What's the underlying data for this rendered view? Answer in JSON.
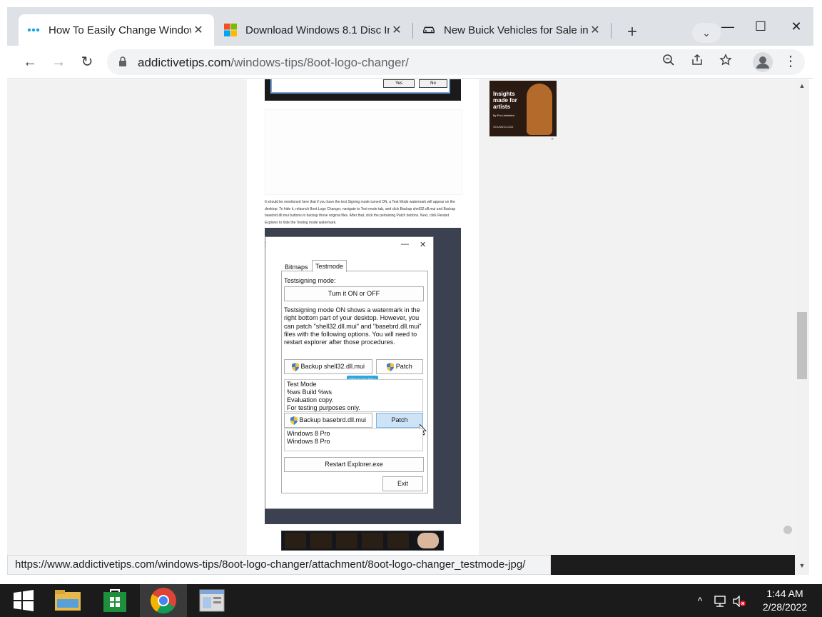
{
  "browser": {
    "tabs": [
      {
        "title": "How To Easily Change Windows 8",
        "active": true,
        "favicon": "dots-icon"
      },
      {
        "title": "Download Windows 8.1 Disc Image",
        "active": false,
        "favicon": "microsoft-logo-icon"
      },
      {
        "title": "New Buick Vehicles for Sale in",
        "active": false,
        "favicon": "car-icon"
      }
    ],
    "new_tab_label": "+",
    "url_host": "addictivetips.com",
    "url_path": "/windows-tips/8oot-logo-changer/",
    "status_url": "https://www.addictivetips.com/windows-tips/8oot-logo-changer/attachment/8oot-logo-changer_testmode-jpg/"
  },
  "article": {
    "top_image_buttons": [
      "Yes",
      "No"
    ],
    "paragraph": "It should be mentioned here that if you have the test Signing mode turned ON, a Test Mode watermark will appear on the desktop. To hide it, relaunch 8oot Logo Changer, navigate to Test mode tab, and click Backup shell32.dll.mui and Backup basebrd.dll.mui buttons to backup those original files. After that, click the pertaining Patch buttons. Next, click Restart Explorer to hide the Testing mode watermark.",
    "dialog": {
      "tab_bitmaps": "Bitmaps",
      "tab_testmode": "Testmode",
      "testsigning_label": "Testsigning mode:",
      "turn_on_off": "Turn it ON or OFF",
      "description": "Testsigning mode ON shows a watermark in the right bottom part of your desktop. However,  you can patch \"shell32.dll.mui\" and \"basebrd.dll.mui\" files with the following options. You will need to restart explorer after those procedures.",
      "backup_shell32": "Backup shell32.dll.mui",
      "patch1": "Patch",
      "view_in_gallery": "VIEW IN GALLERY >",
      "shell32_lines": [
        "Test Mode",
        "%ws Build %ws",
        "Evaluation copy.",
        "For testing purposes only."
      ],
      "backup_basebrd": "Backup basebrd.dll.mui",
      "patch2": "Patch",
      "basebrd_lines": [
        "Windows 8 Pro",
        "Windows 8 Pro"
      ],
      "restart_explorer": "Restart Explorer.exe",
      "exit": "Exit"
    }
  },
  "side_ad": {
    "headline": "Insights made for artists",
    "sub": "By Pro Unlimited",
    "brand": "SOUNDCLOUD"
  },
  "taskbar": {
    "time": "1:44 AM",
    "date": "2/28/2022"
  },
  "colors": {
    "tabstrip": "#dee1e6",
    "omnibox": "#f1f3f4",
    "taskbar": "#1b1b1b",
    "view_badge": "#29a8e0"
  }
}
